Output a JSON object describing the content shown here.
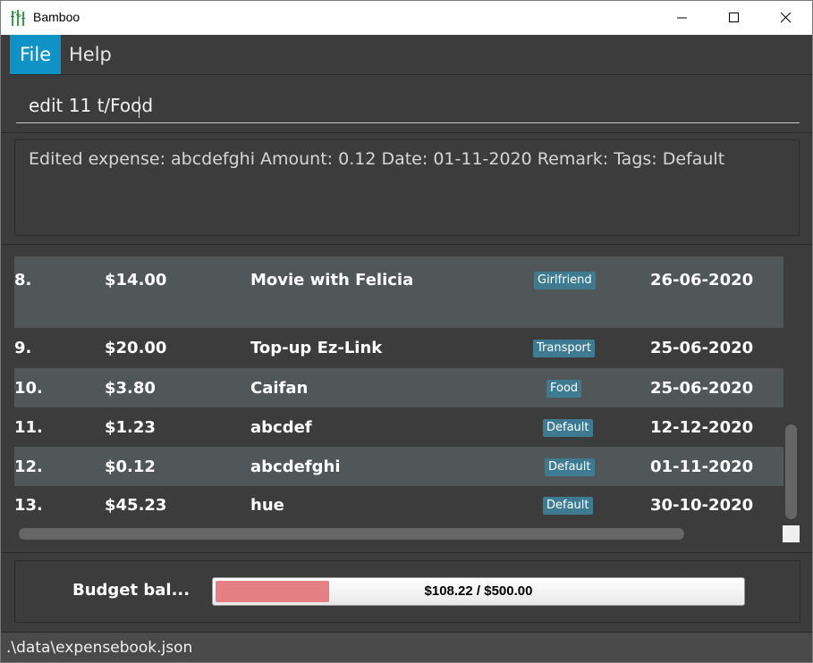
{
  "window": {
    "title": "Bamboo",
    "icon": "bamboo-icon"
  },
  "menu": {
    "items": [
      {
        "label": "File",
        "active": true
      },
      {
        "label": "Help",
        "active": false
      }
    ]
  },
  "command": {
    "value": "edit 11 t/Food"
  },
  "result": {
    "text": "Edited expense: abcdefghi Amount: 0.12 Date: 01-11-2020 Remark:  Tags: Default"
  },
  "expenses": [
    {
      "index": "8.",
      "amount": "$14.00",
      "description": "Movie with Felicia",
      "tag": "Girlfriend",
      "date": "26-06-2020"
    },
    {
      "index": "9.",
      "amount": "$20.00",
      "description": "Top-up Ez-Link",
      "tag": "Transport",
      "date": "25-06-2020"
    },
    {
      "index": "10.",
      "amount": "$3.80",
      "description": "Caifan",
      "tag": "Food",
      "date": "25-06-2020"
    },
    {
      "index": "11.",
      "amount": "$1.23",
      "description": "abcdef",
      "tag": "Default",
      "date": "12-12-2020"
    },
    {
      "index": "12.",
      "amount": "$0.12",
      "description": "abcdefghi",
      "tag": "Default",
      "date": "01-11-2020"
    },
    {
      "index": "13.",
      "amount": "$45.23",
      "description": "hue",
      "tag": "Default",
      "date": "30-10-2020"
    }
  ],
  "budget": {
    "label": "Budget bal...",
    "display": "$108.22 / $500.00",
    "fraction_used": 0.216
  },
  "status": {
    "path": ".\\data\\expensebook.json"
  },
  "colors": {
    "accent": "#0f93c6",
    "tag": "#3e7b91",
    "budget_fill": "#e57f84"
  }
}
